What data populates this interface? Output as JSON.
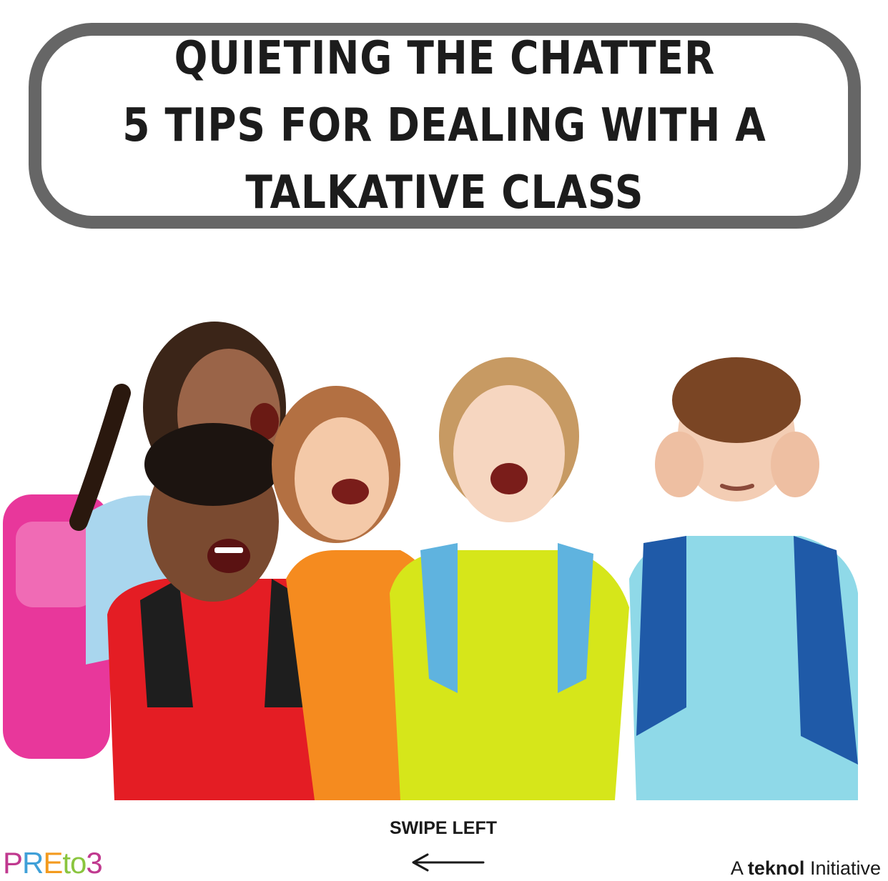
{
  "title": {
    "line1": "QUIETING THE CHATTER",
    "line2": "5 TIPS FOR DEALING WITH A",
    "line3": "TALKATIVE CLASS"
  },
  "footer": {
    "swipe_label": "SWIPE LEFT",
    "swipe_icon": "arrow-left-icon",
    "brand_left": {
      "letters": [
        "P",
        "R",
        "E",
        "t",
        "o",
        "3"
      ],
      "colors": [
        "#c0398f",
        "#3fa0d8",
        "#f39a1e",
        "#8ac53e",
        "#8ac53e",
        "#c0398f"
      ]
    },
    "brand_right": {
      "prefix": "A",
      "name": "teknol",
      "suffix": "Initiative"
    }
  },
  "colors": {
    "banner_border": "#666666",
    "title_text": "#1c1c1c"
  }
}
